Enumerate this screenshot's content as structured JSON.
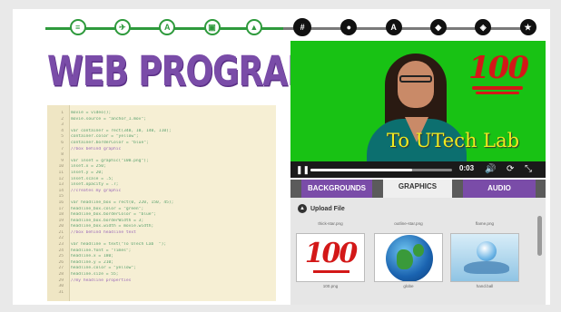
{
  "steps": [
    {
      "glyph": "≡",
      "state": "done"
    },
    {
      "glyph": "✈",
      "state": "done"
    },
    {
      "glyph": "A",
      "state": "done"
    },
    {
      "glyph": "▣",
      "state": "done"
    },
    {
      "glyph": "▲",
      "state": "done"
    },
    {
      "glyph": "#",
      "state": "current"
    },
    {
      "glyph": "●",
      "state": "todo"
    },
    {
      "glyph": "A",
      "state": "todo"
    },
    {
      "glyph": "◆",
      "state": "todo"
    },
    {
      "glyph": "◈",
      "state": "todo"
    },
    {
      "glyph": "★",
      "state": "todo"
    }
  ],
  "title": "WEB PROGRAMMING",
  "code": [
    {
      "n": "1",
      "t": "movie = video();",
      "k": "code"
    },
    {
      "n": "2",
      "t": "movie.source = \"anchor_1.mov\";",
      "k": "code"
    },
    {
      "n": "3",
      "t": "",
      "k": "code"
    },
    {
      "n": "4",
      "t": "var container = rect(340, 10, 140, 110);",
      "k": "code"
    },
    {
      "n": "5",
      "t": "container.color = \"yellow\";",
      "k": "code"
    },
    {
      "n": "6",
      "t": "container.borderColor = \"blue\";",
      "k": "code"
    },
    {
      "n": "7",
      "t": "//box behind graphic",
      "k": "comment"
    },
    {
      "n": "8",
      "t": "",
      "k": "code"
    },
    {
      "n": "9",
      "t": "var inset = graphic(\"100.png\");",
      "k": "code"
    },
    {
      "n": "10",
      "t": "inset.x = 250;",
      "k": "code"
    },
    {
      "n": "11",
      "t": "inset.y = 20;",
      "k": "code"
    },
    {
      "n": "12",
      "t": "inset.scale = .5;",
      "k": "code"
    },
    {
      "n": "13",
      "t": "inset.opacity = .7;",
      "k": "code"
    },
    {
      "n": "14",
      "t": "//creates my graphic",
      "k": "comment"
    },
    {
      "n": "15",
      "t": "",
      "k": "code"
    },
    {
      "n": "16",
      "t": "var headline_box = rect(0, 220, 150, 45);",
      "k": "code"
    },
    {
      "n": "17",
      "t": "headline_box.color = \"green\";",
      "k": "code"
    },
    {
      "n": "18",
      "t": "headline_box.borderColor = \"blue\";",
      "k": "code"
    },
    {
      "n": "19",
      "t": "headline_box.borderWidth = 3;",
      "k": "code"
    },
    {
      "n": "20",
      "t": "headline_box.width = movie.width;",
      "k": "code"
    },
    {
      "n": "21",
      "t": "//box behind headline text",
      "k": "comment"
    },
    {
      "n": "22",
      "t": "",
      "k": "code"
    },
    {
      "n": "23",
      "t": "var headline = text(\"To UTech Lab  \");",
      "k": "code"
    },
    {
      "n": "24",
      "t": "headline.font = \"Times\";",
      "k": "code"
    },
    {
      "n": "25",
      "t": "headline.x = 180;",
      "k": "code"
    },
    {
      "n": "26",
      "t": "headline.y = 210;",
      "k": "code"
    },
    {
      "n": "27",
      "t": "headline.color = \"yellow\";",
      "k": "code"
    },
    {
      "n": "28",
      "t": "headline.size = 55;",
      "k": "code"
    },
    {
      "n": "29",
      "t": "//my headline properties",
      "k": "comment"
    },
    {
      "n": "30",
      "t": "",
      "k": "code"
    },
    {
      "n": "31",
      "t": "",
      "k": "code"
    }
  ],
  "video": {
    "overlay_graphic": "100",
    "headline": "To UTech Lab",
    "time": "0:03",
    "progress": 0.72,
    "play_state_icon": "pause-icon",
    "controls": [
      "volume-icon",
      "replay-icon",
      "fullscreen-icon"
    ]
  },
  "library": {
    "tabs": [
      {
        "label": "BACKGROUNDS",
        "active": false
      },
      {
        "label": "GRAPHICS",
        "active": true
      },
      {
        "label": "AUDIO",
        "active": false
      }
    ],
    "upload_label": "Upload File",
    "top_row_labels": [
      "thick-star.png",
      "outline-star.png",
      "flame.png"
    ],
    "items": [
      {
        "label": "100.png",
        "kind": "hundred"
      },
      {
        "label": "globe",
        "kind": "globe"
      },
      {
        "label": "hand.ball",
        "kind": "hand"
      }
    ]
  },
  "colors": {
    "accent_purple": "#7a4ca8",
    "progress_green": "#2e9a3c",
    "green_screen": "#18c214",
    "headline_yellow": "#f2ea1f",
    "hundred_red": "#d31818"
  }
}
